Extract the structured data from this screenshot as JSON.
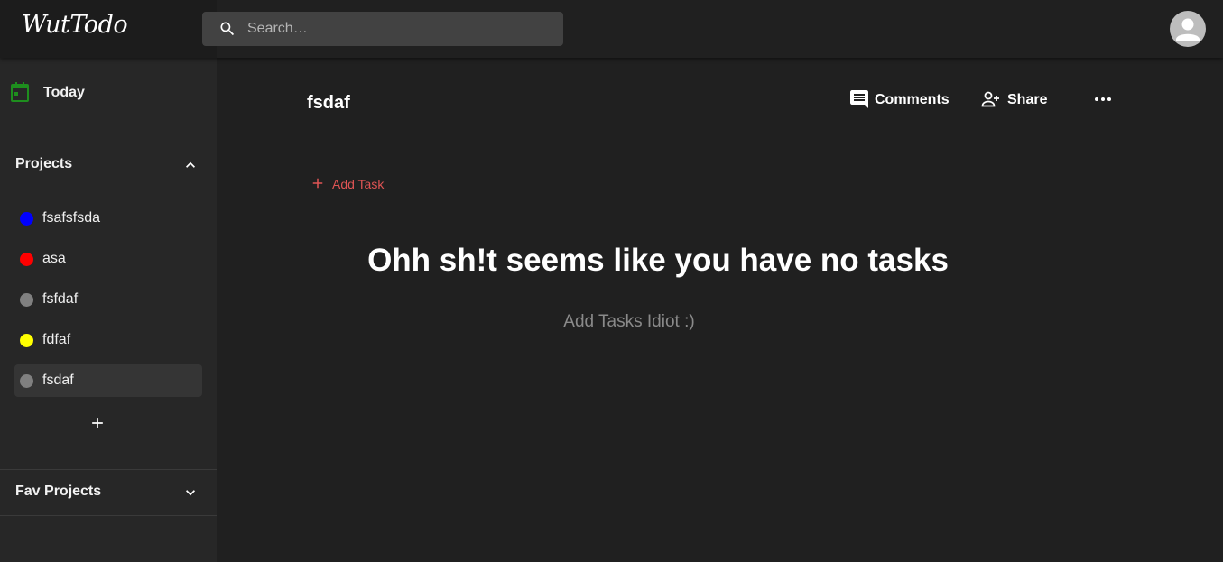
{
  "app": {
    "logo": "WutTodo"
  },
  "search": {
    "placeholder": "Search…",
    "value": ""
  },
  "sidebar": {
    "today_label": "Today",
    "projects": {
      "title": "Projects",
      "expanded": true,
      "items": [
        {
          "name": "fsafsfsda",
          "color": "#0000ff",
          "active": false
        },
        {
          "name": "asa",
          "color": "#ff0000",
          "active": false
        },
        {
          "name": "fsfdaf",
          "color": "#808080",
          "active": false
        },
        {
          "name": "fdfaf",
          "color": "#ffff00",
          "active": false
        },
        {
          "name": "fsdaf",
          "color": "#808080",
          "active": true
        }
      ]
    },
    "fav_projects": {
      "title": "Fav Projects",
      "expanded": false
    }
  },
  "main": {
    "title": "fsdaf",
    "actions": {
      "comments_label": "Comments",
      "share_label": "Share"
    },
    "add_task_label": "Add Task",
    "empty_heading": "Ohh sh!t seems like you have no tasks",
    "empty_subtext": "Add Tasks Idiot :)"
  },
  "colors": {
    "background": "#202020",
    "sidebar": "#272727",
    "accent_red": "#e05454",
    "today_green": "#1e8e1e"
  },
  "icons": {
    "search": "search-icon",
    "avatar": "account-circle-icon",
    "today": "calendar-icon",
    "projects_toggle": "chevron-up-icon",
    "fav_toggle": "chevron-down-icon",
    "add_project": "plus-icon",
    "comments": "comment-icon",
    "share": "person-add-icon",
    "more": "more-horizontal-icon",
    "add_task": "plus-icon"
  }
}
